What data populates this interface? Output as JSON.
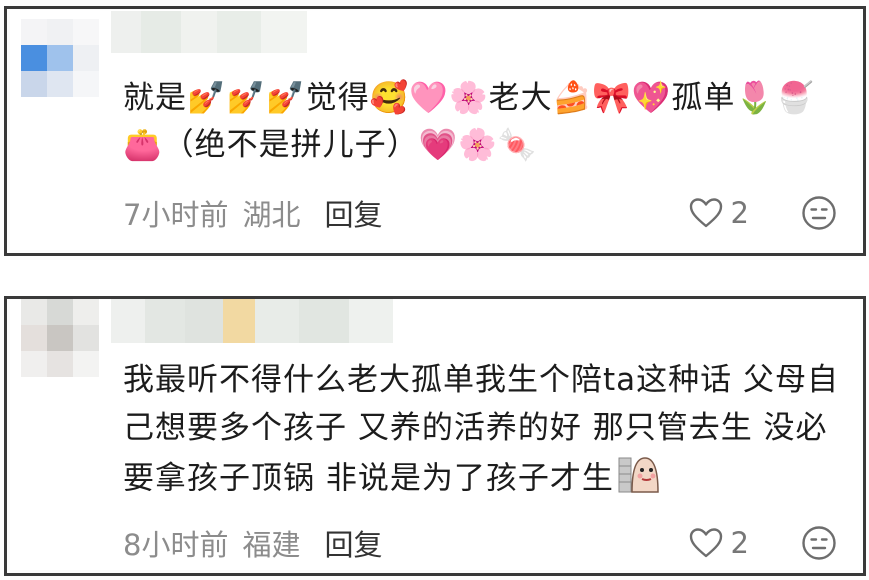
{
  "comments": [
    {
      "text": "就是💅💅💅觉得🥰🩷🌸老大🍰🎀💖孤单🌷🍧👛（绝不是拼儿子）💗🌸🍬",
      "time": "7小时前",
      "location": "湖北",
      "reply_label": "回复",
      "like_count": "2"
    },
    {
      "text": "我最听不得什么老大孤单我生个陪ta这种话 父母自己想要多个孩子 又养的活养的好 那只管去生 没必要拿孩子顶锅 非说是为了孩子才生",
      "time": "8小时前",
      "location": "福建",
      "reply_label": "回复",
      "like_count": "2"
    }
  ],
  "colors": {
    "border": "#3a3a3a",
    "meta_gray": "#8c8c8c",
    "text": "#1c1c1c"
  },
  "icons": {
    "like": "heart-outline-icon",
    "dislike": "frown-face-icon",
    "sticker": "sticker-character-icon"
  }
}
